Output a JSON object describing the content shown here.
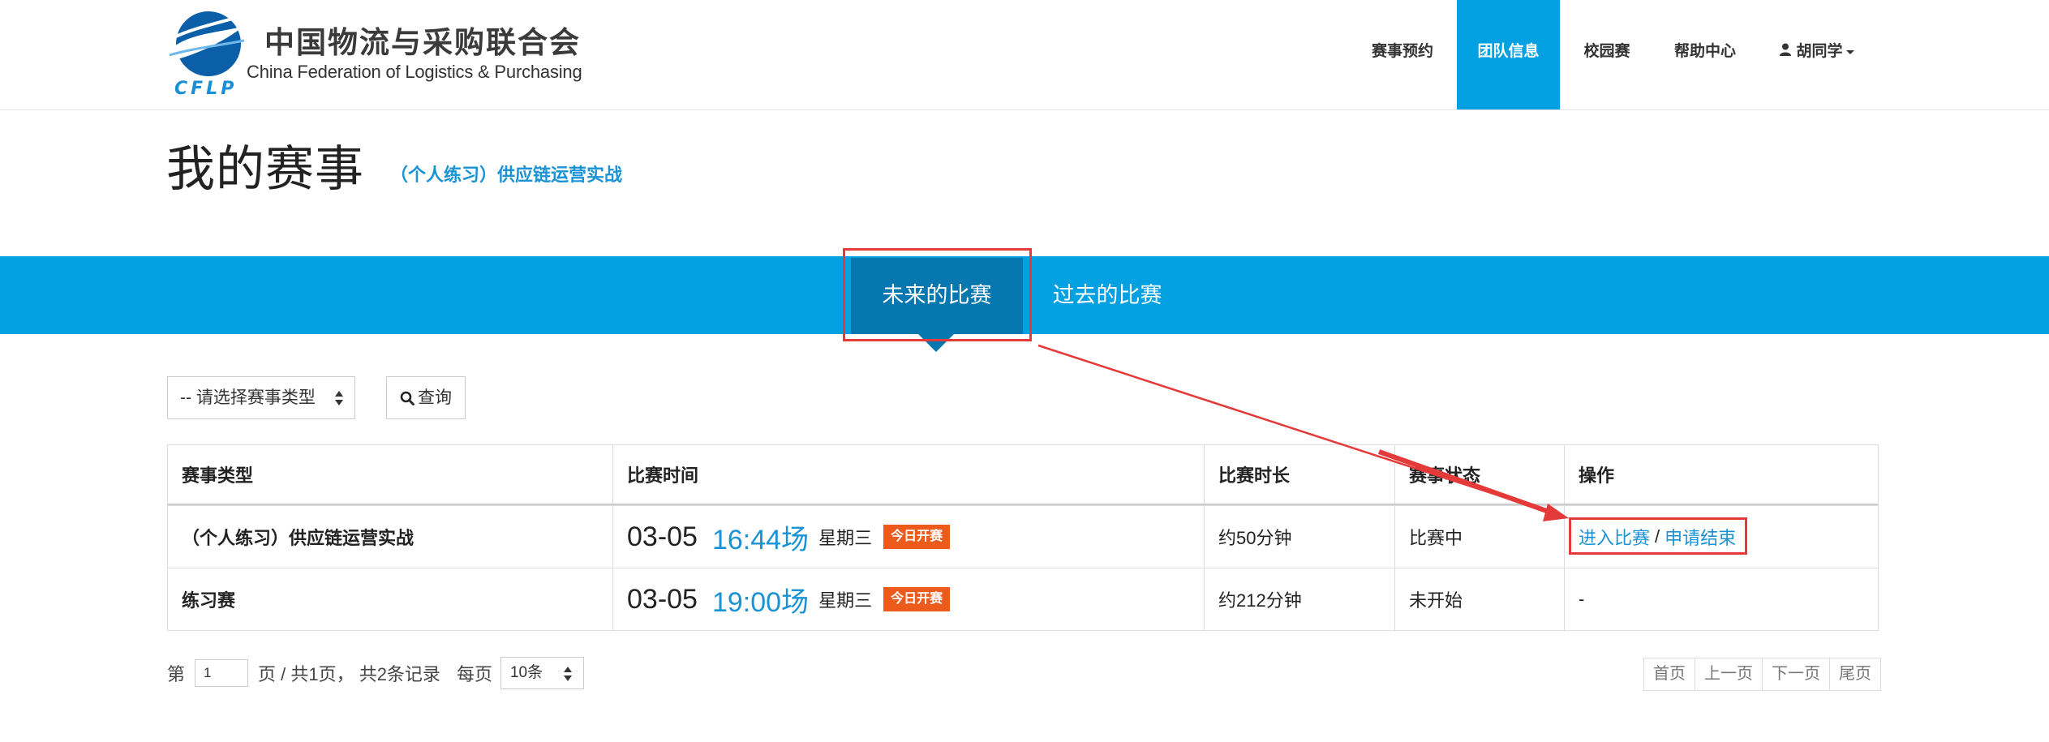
{
  "header": {
    "logo_cn": "中国物流与采购联合会",
    "logo_en": "China Federation of Logistics & Purchasing",
    "logo_abbr": "CFLP",
    "nav": [
      {
        "label": "赛事预约",
        "active": false
      },
      {
        "label": "团队信息",
        "active": true
      },
      {
        "label": "校园赛",
        "active": false
      },
      {
        "label": "帮助中心",
        "active": false
      },
      {
        "label": "胡同学",
        "active": false
      }
    ]
  },
  "page": {
    "title": "我的赛事",
    "subtitle": "（个人练习）供应链运营实战"
  },
  "tabs": {
    "future": "未来的比赛",
    "past": "过去的比赛"
  },
  "filters": {
    "type_select": "-- 请选择赛事类型",
    "query_button": "查询"
  },
  "table": {
    "headers": [
      "赛事类型",
      "比赛时间",
      "比赛时长",
      "赛事状态",
      "操作"
    ],
    "rows": [
      {
        "type": "（个人练习）供应链运营实战",
        "date": "03-05",
        "time": "16:44场",
        "weekday": "星期三",
        "badge": "今日开赛",
        "duration": "约50分钟",
        "status": "比赛中",
        "action_enter": "进入比赛",
        "action_sep": "/",
        "action_end": "申请结束"
      },
      {
        "type": "练习赛",
        "date": "03-05",
        "time": "19:00场",
        "weekday": "星期三",
        "badge": "今日开赛",
        "duration": "约212分钟",
        "status": "未开始",
        "action": "-"
      }
    ]
  },
  "pagination": {
    "prefix": "第",
    "current_page": "1",
    "summary": "页 / 共1页，  共2条记录",
    "per_page_label": "每页",
    "per_page_value": "10条",
    "first": "首页",
    "prev": "上一页",
    "next": "下一页",
    "last": "尾页"
  },
  "colors": {
    "brand_blue": "#03a0e2",
    "tab_active": "#0777b0",
    "link_blue": "#1a93d5",
    "badge_orange": "#ec5a1c",
    "annotation_red": "#e53a3a"
  }
}
